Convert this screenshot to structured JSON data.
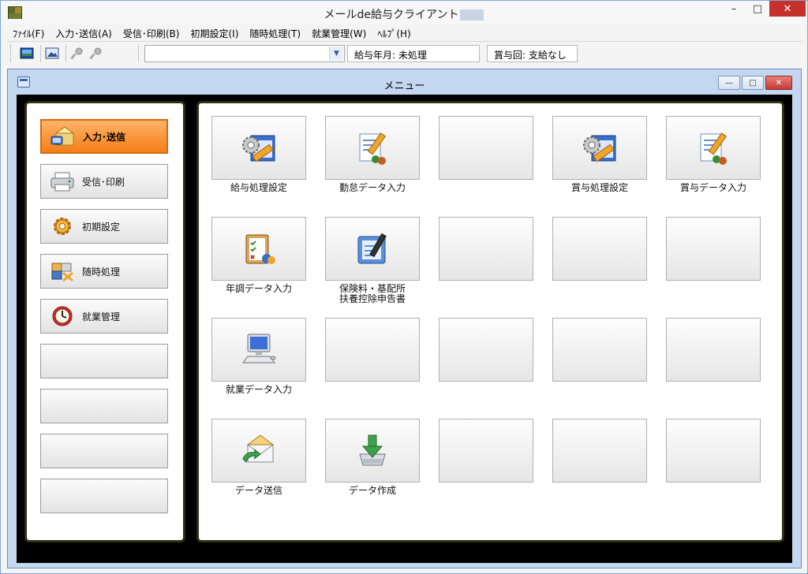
{
  "window": {
    "title": "メールde給与クライアント",
    "controls": {
      "minimize": "–",
      "maximize": "□",
      "close": "✕"
    }
  },
  "menubar": [
    {
      "label": "ﾌｧｲﾙ(F)"
    },
    {
      "label": "入力･送信(A)"
    },
    {
      "label": "受信･印刷(B)"
    },
    {
      "label": "初期設定(I)"
    },
    {
      "label": "随時処理(T)"
    },
    {
      "label": "就業管理(W)"
    },
    {
      "label": "ﾍﾙﾌﾟ(H)"
    }
  ],
  "toolbar": {
    "combo_value": "",
    "pay_period": "給与年月: 未処理",
    "bonus_period": "賞与回: 支給なし"
  },
  "child_window": {
    "title": "メニュー",
    "controls": {
      "minimize": "—",
      "maximize": "□",
      "close": "✕"
    }
  },
  "nav": [
    {
      "label": "入力･送信",
      "active": true,
      "icon": "envelope-icon"
    },
    {
      "label": "受信･印刷",
      "active": false,
      "icon": "printer-icon"
    },
    {
      "label": "初期設定",
      "active": false,
      "icon": "gear-icon"
    },
    {
      "label": "随時処理",
      "active": false,
      "icon": "puzzle-icon"
    },
    {
      "label": "就業管理",
      "active": false,
      "icon": "clock-icon"
    },
    {
      "label": "",
      "active": false,
      "icon": ""
    },
    {
      "label": "",
      "active": false,
      "icon": ""
    },
    {
      "label": "",
      "active": false,
      "icon": ""
    },
    {
      "label": "",
      "active": false,
      "icon": ""
    }
  ],
  "tiles": [
    {
      "label": "給与処理設定",
      "icon": "settings-window-icon"
    },
    {
      "label": "勤怠データ入力",
      "icon": "document-edit-icon"
    },
    {
      "label": "",
      "icon": ""
    },
    {
      "label": "賞与処理設定",
      "icon": "settings-window-icon"
    },
    {
      "label": "賞与データ入力",
      "icon": "document-edit-icon"
    },
    {
      "label": "年調データ入力",
      "icon": "checklist-icon"
    },
    {
      "label": "保険料・基配所\n扶養控除申告書",
      "icon": "form-pen-icon"
    },
    {
      "label": "",
      "icon": ""
    },
    {
      "label": "",
      "icon": ""
    },
    {
      "label": "",
      "icon": ""
    },
    {
      "label": "就業データ入力",
      "icon": "computer-icon"
    },
    {
      "label": "",
      "icon": ""
    },
    {
      "label": "",
      "icon": ""
    },
    {
      "label": "",
      "icon": ""
    },
    {
      "label": "",
      "icon": ""
    },
    {
      "label": "データ送信",
      "icon": "send-mail-icon"
    },
    {
      "label": "データ作成",
      "icon": "download-tray-icon"
    },
    {
      "label": "",
      "icon": ""
    },
    {
      "label": "",
      "icon": ""
    },
    {
      "label": "",
      "icon": ""
    }
  ]
}
